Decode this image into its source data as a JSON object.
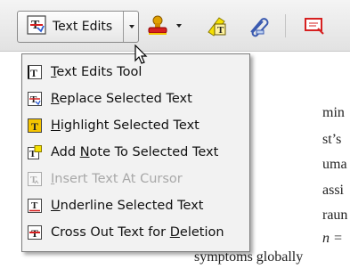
{
  "toolbar": {
    "text_edits_label": "Text Edits"
  },
  "document": {
    "lines": [
      "min",
      "st’s",
      "uma",
      "assi",
      "raun",
      "n =",
      "symptoms globally"
    ]
  },
  "menu": {
    "items": [
      {
        "pre": "",
        "key": "T",
        "post": "ext Edits Tool",
        "icon": "text-edits-tool-icon",
        "enabled": true
      },
      {
        "pre": "",
        "key": "R",
        "post": "eplace Selected Text",
        "icon": "replace-text-icon",
        "enabled": true
      },
      {
        "pre": "",
        "key": "H",
        "post": "ighlight Selected Text",
        "icon": "highlight-text-icon",
        "enabled": true
      },
      {
        "pre": "Add ",
        "key": "N",
        "post": "ote To Selected Text",
        "icon": "add-note-icon",
        "enabled": true
      },
      {
        "pre": "",
        "key": "I",
        "post": "nsert Text At Cursor",
        "icon": "insert-text-icon",
        "enabled": false
      },
      {
        "pre": "",
        "key": "U",
        "post": "nderline Selected Text",
        "icon": "underline-text-icon",
        "enabled": true
      },
      {
        "pre": "Cross Out Text for ",
        "key": "D",
        "post": "eletion",
        "icon": "cross-out-text-icon",
        "enabled": true
      }
    ]
  },
  "colors": {
    "highlight_yellow": "#f5c400",
    "markup_red": "#d62020",
    "menu_bg": "#f2f2f2"
  }
}
